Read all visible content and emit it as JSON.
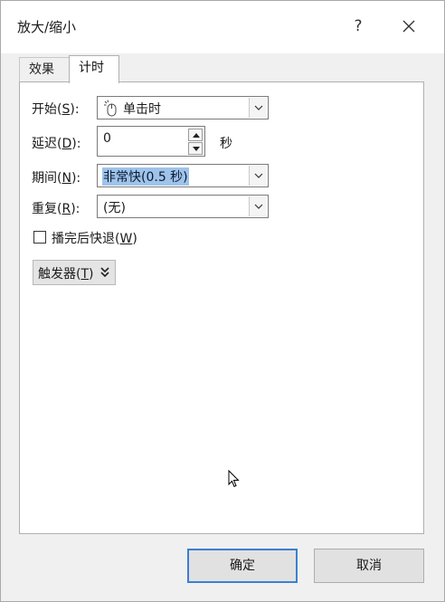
{
  "window": {
    "title": "放大/缩小",
    "help": "?"
  },
  "tabs": [
    {
      "label": "效果"
    },
    {
      "label": "计时"
    }
  ],
  "timing": {
    "start": {
      "label": "开始(S):",
      "value": "单击时",
      "icon": "mouse-click-icon"
    },
    "delay": {
      "label": "延迟(D):",
      "value": "0",
      "unit": "秒"
    },
    "duration": {
      "label": "期间(N):",
      "value": "非常快(0.5 秒)"
    },
    "repeat": {
      "label": "重复(R):",
      "value": "(无)"
    },
    "rewind": {
      "label": "播完后快退(W)",
      "checked": false
    },
    "triggers": {
      "label": "触发器(T)",
      "icon": "double-chevron-down-icon"
    }
  },
  "buttons": {
    "ok": "确定",
    "cancel": "取消"
  }
}
